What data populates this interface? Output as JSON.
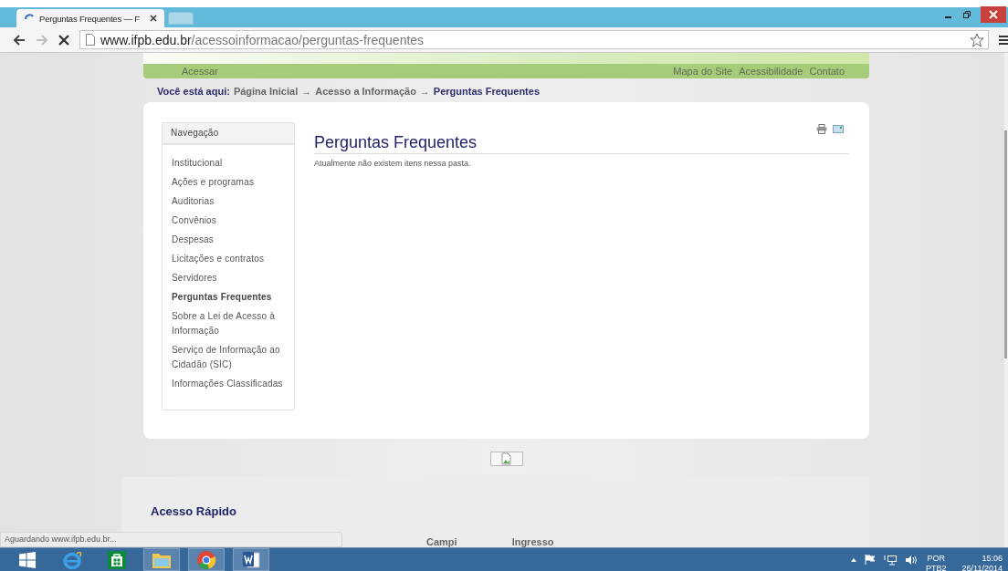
{
  "browser": {
    "tab": {
      "title": "Perguntas Frequentes — F",
      "loading": true
    },
    "address": {
      "host": "www.ifpb.edu.br",
      "path": "/acessoinformacao/perguntas-frequentes"
    },
    "status": "Aguardando www.ifpb.edu.br..."
  },
  "header": {
    "left_link": "Acessar",
    "links": [
      "Mapa do Site",
      "Acessibilidade",
      "Contato"
    ]
  },
  "breadcrumb": {
    "label": "Você está aqui:",
    "items": [
      {
        "kind": "link",
        "text": "Página Inicial"
      },
      {
        "kind": "separator",
        "text": "→"
      },
      {
        "kind": "link",
        "text": "Acesso a Informação"
      },
      {
        "kind": "separator",
        "text": "→"
      },
      {
        "kind": "current",
        "text": "Perguntas Frequentes"
      }
    ]
  },
  "navigation": {
    "title": "Navegação",
    "items": [
      {
        "label": "Institucional",
        "selected": false
      },
      {
        "label": "Ações e programas",
        "selected": false
      },
      {
        "label": "Auditorias",
        "selected": false
      },
      {
        "label": "Convênios",
        "selected": false
      },
      {
        "label": "Despesas",
        "selected": false
      },
      {
        "label": "Licitações e contratos",
        "selected": false
      },
      {
        "label": "Servidores",
        "selected": false
      },
      {
        "label": "Perguntas Frequentes",
        "selected": true
      },
      {
        "label": "Sobre a Lei de Acesso à Informação",
        "selected": false
      },
      {
        "label": "Serviço de Informação ao Cidadão (SIC)",
        "selected": false
      },
      {
        "label": "Informações Classificadas",
        "selected": false
      }
    ]
  },
  "content": {
    "title": "Perguntas Frequentes",
    "message": "Atualmente não existem itens nessa pasta."
  },
  "footer": {
    "title": "Acesso Rápido",
    "columns": [
      "Campi",
      "Ingresso"
    ]
  },
  "taskbar": {
    "apps": [
      {
        "kind": "start",
        "running": false
      },
      {
        "kind": "ie",
        "running": false
      },
      {
        "kind": "store",
        "running": false
      },
      {
        "kind": "explorer",
        "running": true
      },
      {
        "kind": "chrome",
        "running": true
      },
      {
        "kind": "word",
        "running": true
      }
    ],
    "language": [
      "POR",
      "PTB2"
    ],
    "time": "15:06",
    "date": "26/11/2014"
  }
}
